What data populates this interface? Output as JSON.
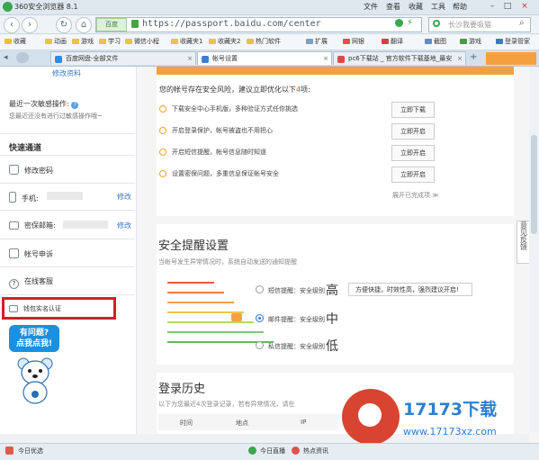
{
  "browser": {
    "title": "360安全浏览器 8.1",
    "menus": [
      "文件",
      "查看",
      "收藏",
      "工具",
      "帮助"
    ],
    "address": {
      "site_tag": "百度",
      "url": "https://passport.baidu.com/center",
      "search_placeholder": "长沙我要吸猫"
    },
    "bookmarks": [
      "收藏",
      "动画",
      "游戏",
      "学习",
      "微信小程",
      "收藏夹1",
      "收藏夹2",
      "热门软件",
      "扩展",
      "网银",
      "翻译",
      "截图",
      "游戏",
      "登录管家"
    ],
    "tabs": [
      {
        "label": "百度网盘-全部文件",
        "active": false
      },
      {
        "label": "帐号设置",
        "active": true
      },
      {
        "label": "pc6下载站 _ 官方软件下载基地_最安",
        "active": false
      }
    ]
  },
  "sidebar": {
    "edit_info": "修改资料",
    "last_op_title": "最近一次敏感操作:",
    "last_op_text": "您最近还没有进行过敏感操作哦~",
    "quick_title": "快速通道",
    "items": [
      {
        "label": "修改密码",
        "icon": "lock-icon"
      },
      {
        "label": "手机:",
        "icon": "phone-icon",
        "action": "修改"
      },
      {
        "label": "密保邮箱:",
        "icon": "mail-icon",
        "action": "修改"
      },
      {
        "label": "帐号申诉",
        "icon": "document-icon"
      },
      {
        "label": "在线客服",
        "icon": "help-icon"
      },
      {
        "label": "钱包实名认证",
        "icon": "id-card-icon"
      }
    ],
    "mascot_text": "有问题?\n点我点我!"
  },
  "risk": {
    "headline_prefix": "您的帐号存在安全风险，建议立即优化以下",
    "headline_count": "4",
    "headline_suffix": "项:",
    "items": [
      {
        "text": "下载安全中心手机版，多种验证方式任你挑选",
        "action": "立即下载"
      },
      {
        "text": "开启登录保护，帐号被盗也不用担心",
        "action": "立即开启"
      },
      {
        "text": "开启短信提醒，帐号信息随时知道",
        "action": "立即开启"
      },
      {
        "text": "设置密保问题，多重信息保证帐号安全",
        "action": "立即开启"
      }
    ],
    "expand_label": "展开已完成项 ≫"
  },
  "alerts": {
    "title": "安全提醒设置",
    "subtitle": "当帐号发生异常情况时，系统自动发送的通知提醒",
    "options": [
      {
        "label": "短信提醒：安全级别",
        "level": "高",
        "selected": false
      },
      {
        "label": "邮件提醒：安全级别",
        "level": "中",
        "selected": true
      },
      {
        "label": "私信提醒：安全级别",
        "level": "低",
        "selected": false
      }
    ],
    "tooltip": "方便快捷，时效性高，强烈建议开启!",
    "bar_colors": [
      "#e8574a",
      "#f07a43",
      "#f5a040",
      "#f5c34c",
      "#b7d66a",
      "#7cc776",
      "#5fb95c"
    ]
  },
  "history": {
    "title": "登录历史",
    "subtitle": "以下为您最近4次登录记录，若有异常情况，请在",
    "columns": [
      "时间",
      "地点",
      "IP"
    ]
  },
  "feedback": "意见反馈",
  "status": {
    "left": "今日优选",
    "right": [
      "今日直播",
      "热点资讯"
    ]
  },
  "watermark": {
    "brand": "17173下载",
    "url": "www.17173xz.com"
  }
}
